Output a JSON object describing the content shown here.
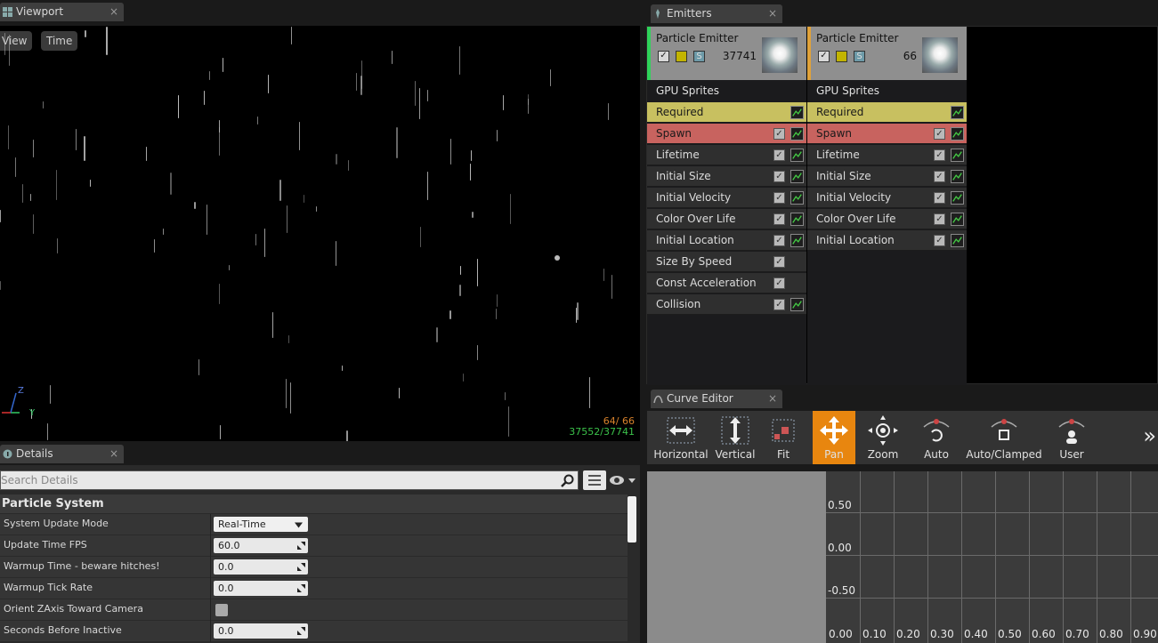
{
  "viewport_panel": {
    "tab_title": "Viewport",
    "close": "×",
    "view_btn": "View",
    "time_btn": "Time",
    "axis_z": "Z",
    "axis_y": "Y",
    "stats_line1": "64/  66",
    "stats_line2": "37552/37741"
  },
  "emitters_panel": {
    "tab_title": "Emitters",
    "close": "×",
    "emitters": [
      {
        "name": "Particle Emitter",
        "count": "37741",
        "accent": "#2fd35a",
        "type_label": "GPU Sprites",
        "modules": [
          "Required",
          "Spawn",
          "Lifetime",
          "Initial Size",
          "Initial Velocity",
          "Color Over Life",
          "Initial Location",
          "Size By Speed",
          "Const Acceleration",
          "Collision"
        ]
      },
      {
        "name": "Particle Emitter",
        "count": "66",
        "accent": "#e0a23a",
        "type_label": "GPU Sprites",
        "modules": [
          "Required",
          "Spawn",
          "Lifetime",
          "Initial Size",
          "Initial Velocity",
          "Color Over Life",
          "Initial Location"
        ]
      }
    ]
  },
  "curve_editor": {
    "tab_title": "Curve Editor",
    "close": "×",
    "tools": [
      {
        "label": "Horizontal",
        "icon": "horizontal-fit-icon"
      },
      {
        "label": "Vertical",
        "icon": "vertical-fit-icon"
      },
      {
        "label": "Fit",
        "icon": "fit-icon"
      },
      {
        "label": "Pan",
        "icon": "pan-icon",
        "active": true
      },
      {
        "label": "Zoom",
        "icon": "zoom-icon"
      },
      {
        "label": "Auto",
        "icon": "auto-tangent-icon"
      },
      {
        "label": "Auto/Clamped",
        "icon": "auto-clamped-tangent-icon"
      },
      {
        "label": "User",
        "icon": "user-tangent-icon"
      }
    ],
    "overflow": "»",
    "y_labels": [
      "0.50",
      "0.00",
      "-0.50"
    ],
    "x_labels": [
      "0.00",
      "0.10",
      "0.20",
      "0.30",
      "0.40",
      "0.50",
      "0.60",
      "0.70",
      "0.80",
      "0.90"
    ]
  },
  "details_panel": {
    "tab_title": "Details",
    "close": "×",
    "search_placeholder": "Search Details",
    "section_title": "Particle System",
    "properties": [
      {
        "label": "System Update Mode",
        "value": "Real-Time",
        "kind": "dropdown"
      },
      {
        "label": "Update Time FPS",
        "value": "60.0",
        "kind": "number"
      },
      {
        "label": "Warmup Time - beware hitches!",
        "value": "0.0",
        "kind": "number"
      },
      {
        "label": "Warmup Tick Rate",
        "value": "0.0",
        "kind": "number"
      },
      {
        "label": "Orient ZAxis Toward Camera",
        "value": "",
        "kind": "checkbox"
      },
      {
        "label": "Seconds Before Inactive",
        "value": "0.0",
        "kind": "number"
      }
    ]
  },
  "colors": {
    "required_module": "#c8c060",
    "spawn_module": "#c8635f",
    "pan_active": "#e8860f",
    "stats_orange": "#d9822b",
    "stats_green": "#3bc24a"
  }
}
